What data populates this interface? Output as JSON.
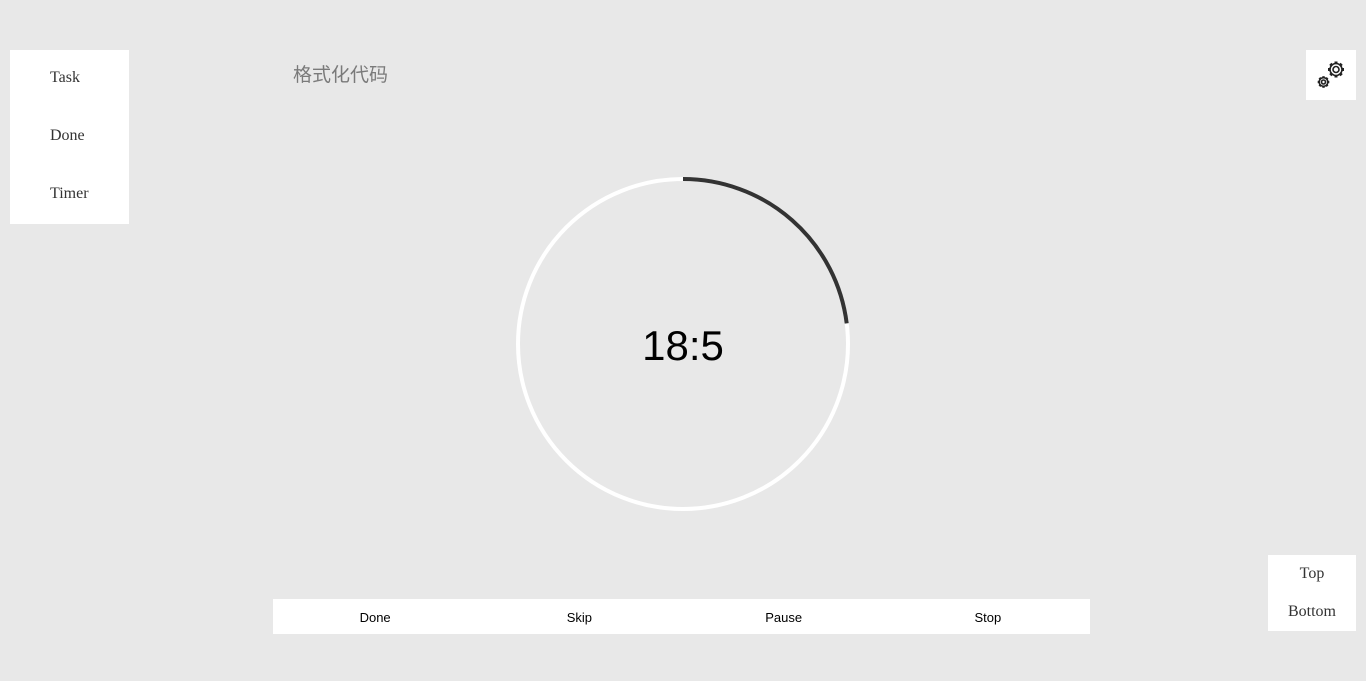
{
  "sidebar": {
    "items": [
      {
        "label": "Task"
      },
      {
        "label": "Done"
      },
      {
        "label": "Timer"
      }
    ]
  },
  "task": {
    "title": "格式化代码"
  },
  "settings": {
    "icon": "gears-icon"
  },
  "timer": {
    "display": "18:5",
    "progress": 0.23,
    "track_color": "#ffffff",
    "progress_color": "#333333"
  },
  "controls": {
    "done_label": "Done",
    "skip_label": "Skip",
    "pause_label": "Pause",
    "stop_label": "Stop"
  },
  "scroll": {
    "top_label": "Top",
    "bottom_label": "Bottom"
  }
}
